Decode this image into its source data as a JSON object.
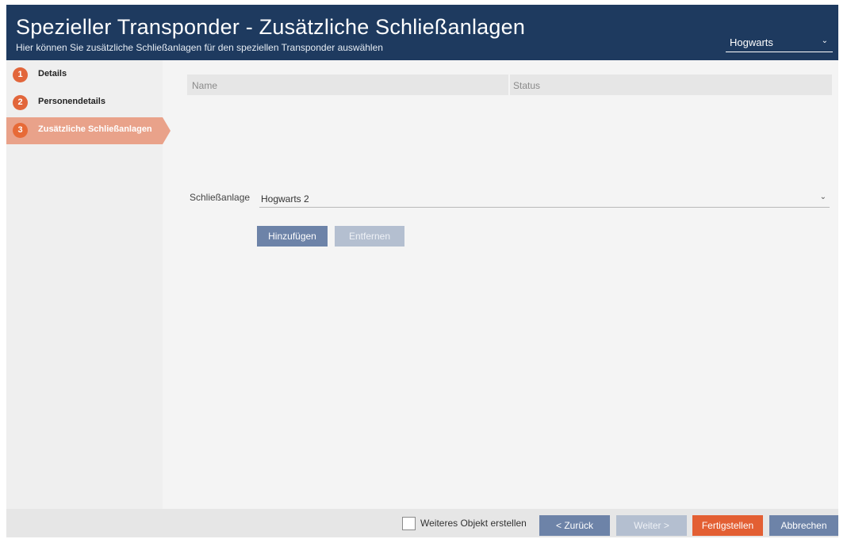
{
  "header": {
    "title": "Spezieller Transponder - Zusätzliche Schließanlagen",
    "subtitle": "Hier können Sie zusätzliche Schließanlagen für den speziellen Transponder auswählen",
    "system_select_value": "Hogwarts"
  },
  "sidebar": {
    "steps": [
      {
        "number": "1",
        "label": "Details"
      },
      {
        "number": "2",
        "label": "Personendetails"
      },
      {
        "number": "3",
        "label": "Zusätzliche Schließanlagen",
        "active": true
      }
    ]
  },
  "table": {
    "columns": [
      "Name",
      "Status"
    ],
    "rows": []
  },
  "form": {
    "lock_label": "Schließanlage",
    "lock_value": "Hogwarts 2",
    "add_label": "Hinzufügen",
    "remove_label": "Entfernen"
  },
  "footer": {
    "checkbox_label": "Weiteres Objekt erstellen",
    "back_label": "< Zurück",
    "next_label": "Weiter >",
    "finish_label": "Fertigstellen",
    "cancel_label": "Abbrechen"
  },
  "colors": {
    "header_bg": "#1e3a5f",
    "accent_orange": "#e35f33",
    "button_blue": "#6d83a8"
  },
  "icons": {
    "dropdown": "chevron-down-icon"
  }
}
